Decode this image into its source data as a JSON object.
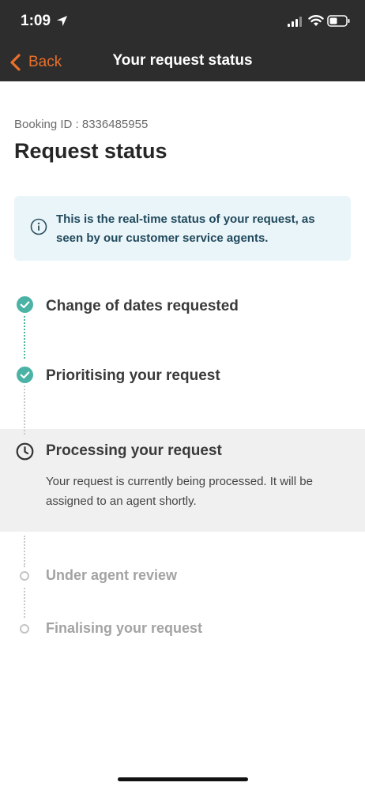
{
  "status_bar": {
    "time": "1:09",
    "icons": [
      "location-arrow-icon",
      "signal-icon",
      "wifi-icon",
      "battery-icon"
    ]
  },
  "nav": {
    "back_label": "Back",
    "title": "Your request status"
  },
  "booking": {
    "id_text": "Booking ID : 8336485955"
  },
  "page_title": "Request status",
  "info": {
    "icon": "info-icon",
    "text": "This is the real-time status of your request, as seen by our customer service agents."
  },
  "steps": [
    {
      "label": "Change of dates requested",
      "state": "done"
    },
    {
      "label": "Prioritising your request",
      "state": "done"
    },
    {
      "label": "Processing your request",
      "state": "active",
      "description": "Your request is currently being processed. It will be assigned to an agent shortly."
    },
    {
      "label": "Under agent review",
      "state": "pending"
    },
    {
      "label": "Finalising your request",
      "state": "pending"
    }
  ],
  "colors": {
    "header_bg": "#2d2d2d",
    "accent_orange": "#e8702a",
    "done_teal": "#4bb3a5",
    "info_bg": "#eaf5f9",
    "active_bg": "#f0f0f0"
  }
}
